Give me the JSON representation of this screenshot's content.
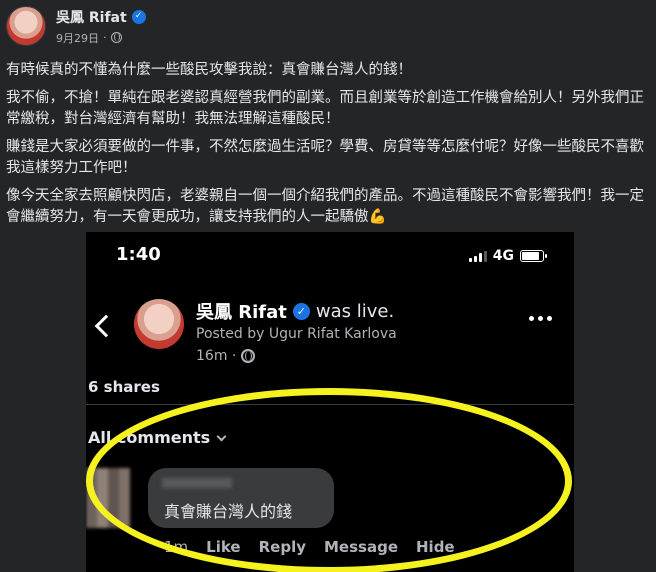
{
  "post": {
    "author": "吳鳳 Rifat",
    "date": "9月29日",
    "paragraphs": [
      "有時候真的不懂為什麼一些酸民攻擊我說：真會賺台灣人的錢！",
      "我不偷，不搶！單純在跟老婆認真經營我們的副業。而且創業等於創造工作機會給別人！另外我們正常繳稅，對台灣經濟有幫助！我無法理解這種酸民！",
      "賺錢是大家必須要做的一件事，不然怎麼過生活呢？學費、房貸等等怎麼付呢？好像一些酸民不喜歡我這樣努力工作吧！",
      "像今天全家去照顧快閃店，老婆親自一個一個介紹我們的產品。不過這種酸民不會影響我們！我一定會繼續努力，有一天會更成功，讓支持我們的人一起驕傲💪"
    ]
  },
  "phone": {
    "status": {
      "time": "1:40",
      "network": "4G",
      "signal_bars": 3,
      "battery_level": 0.85
    },
    "live_post": {
      "name": "吳鳳 Rifat",
      "status": "was live.",
      "posted_by": "Posted by Ugur Rifat Karlova",
      "time_ago": "16m ·"
    },
    "shares": "6 shares",
    "comments_filter": "All comments",
    "comment": {
      "text": "真會賺台灣人的錢",
      "time": "1m",
      "actions": [
        "Like",
        "Reply",
        "Message",
        "Hide"
      ]
    }
  },
  "colors": {
    "verified": "#1b74e4",
    "highlight": "#f5f21f",
    "background": "#242526"
  }
}
